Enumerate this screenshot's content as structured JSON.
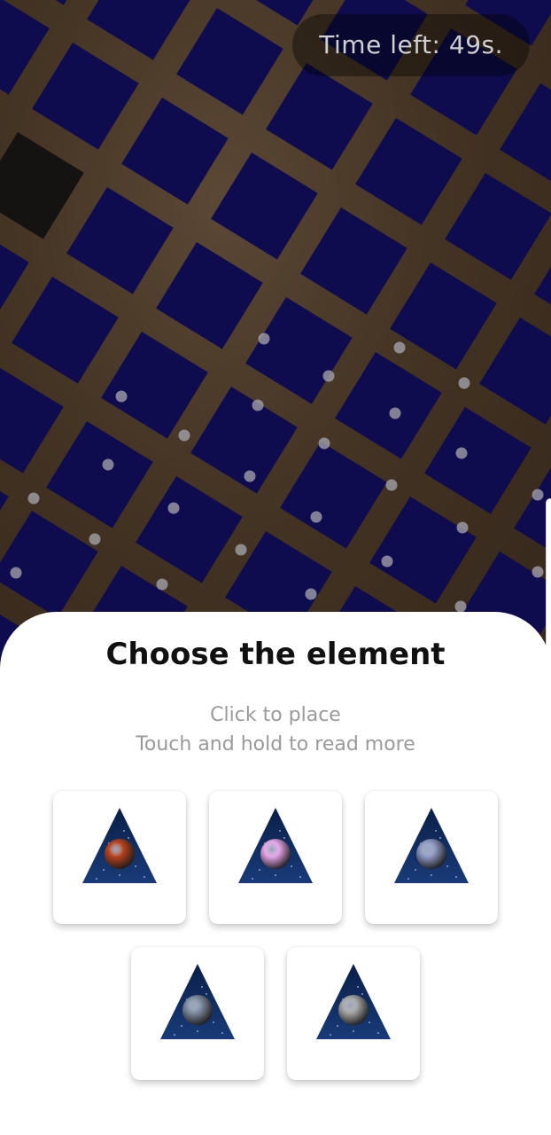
{
  "timer": {
    "text": "Time left: 49s."
  },
  "panel": {
    "title": "Choose the element",
    "subtitle_line1": "Click to place",
    "subtitle_line2": "Touch and hold to read more"
  },
  "elements": [
    {
      "icon": "red-planet-triangle-icon",
      "planet_color": "#b8421c"
    },
    {
      "icon": "pink-planet-triangle-icon",
      "planet_color": "#e6a6e8"
    },
    {
      "icon": "blue-planet-triangle-icon",
      "planet_color": "#8f9ac4"
    },
    {
      "icon": "gray-blue-planet-triangle-icon",
      "planet_color": "#7f8da1"
    },
    {
      "icon": "gray-moon-triangle-icon",
      "planet_color": "#a7a7a7"
    }
  ],
  "colors": {
    "tile_blue": "#0d0c5e",
    "tile_black": "#141414",
    "tile_magenta": "#8a0f7e",
    "wood": "#5c4632",
    "triangle_space": "#183b78"
  }
}
